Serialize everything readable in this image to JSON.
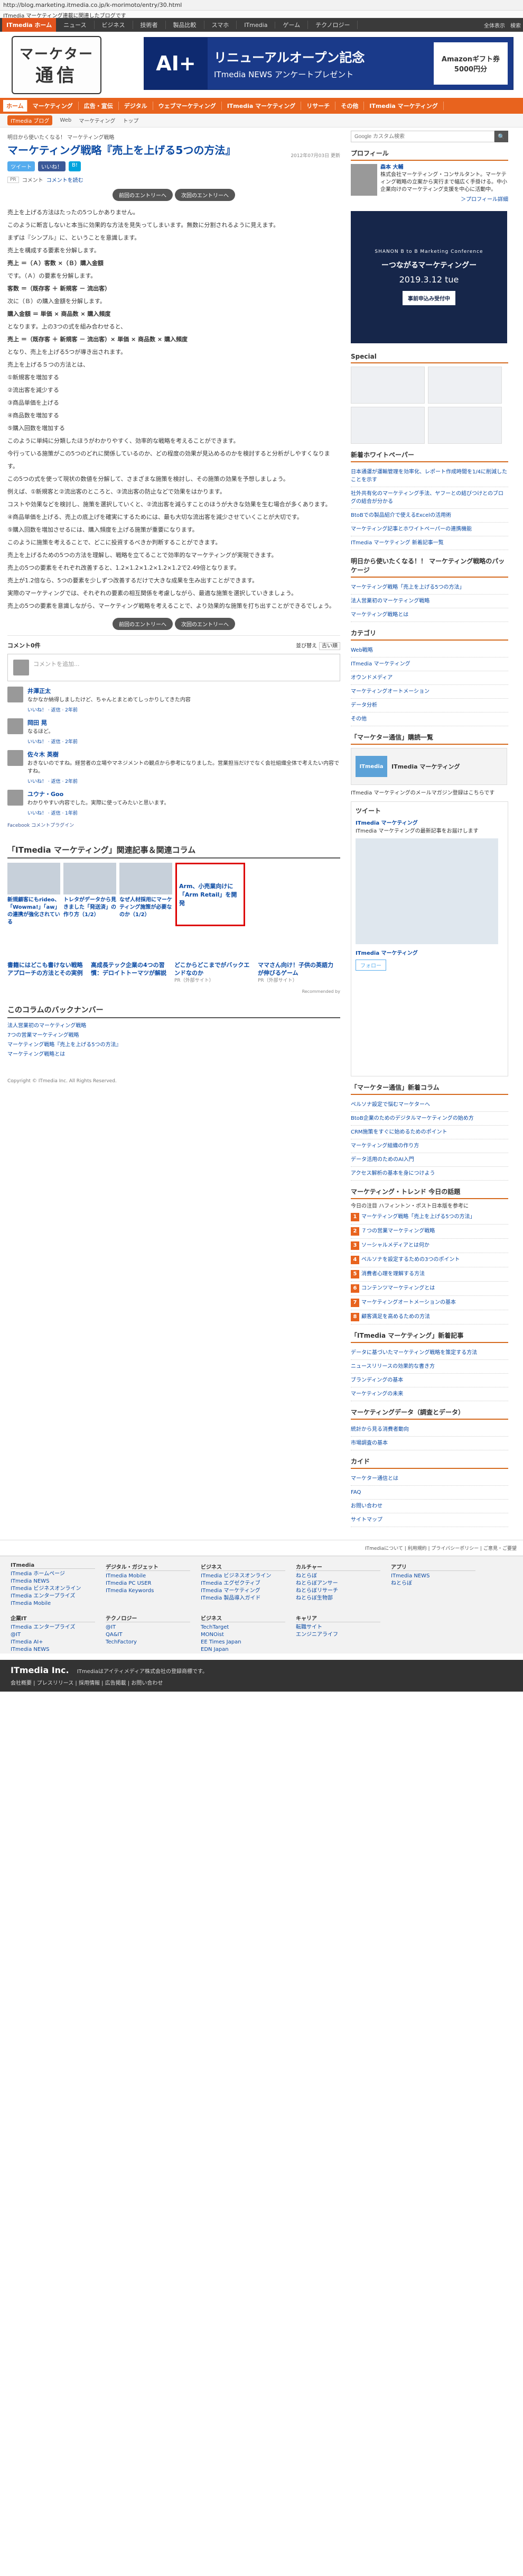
{
  "url": "http://blog.marketing.itmedia.co.jp/k-morimoto/entry/30.html",
  "infobar": "ITmedia マーケティング連載に関連したブログです",
  "topnav": {
    "home": "ITmedia ホーム",
    "items": [
      "ニュース",
      "ビジネス",
      "技術者",
      "製品比較",
      "スマホ",
      "ITmedia",
      "ゲーム",
      "テクノロジー"
    ],
    "right": [
      "全体表示",
      "検索"
    ]
  },
  "logo": {
    "line1": "マーケター",
    "line2": "通信"
  },
  "banner": {
    "left": "AI+",
    "title": "リニューアルオープン記念",
    "sub": "ITmedia NEWS アンケートプレゼント",
    "right": "Amazonギフト券 5000円分"
  },
  "catnav": [
    "ホーム",
    "マーケティング",
    "広告・宣伝",
    "デジタル",
    "ウェブマーケティング",
    "ITmedia マーケティング",
    "リサーチ",
    "その他",
    "ITmedia マーケティング"
  ],
  "crumb": {
    "s": "ITmedia ブログ",
    "items": [
      "Web",
      "マーケティング",
      "トップ"
    ]
  },
  "article": {
    "kicker": "明日から使いたくなる！ マーケティング戦略",
    "title": "マーケティング戦略『売上を上げる5つの方法』",
    "date": "2012年07月03日 更新",
    "social": [
      "ツイート",
      "いいね！",
      "B!"
    ],
    "meta": [
      "コメント",
      "コメントを読む"
    ],
    "tag": "PR",
    "nav_prev": "前回のエントリーへ",
    "nav_next": "次回のエントリーへ",
    "paragraphs": [
      "売上を上げる方法はたったの5つしかありません。",
      "このように断言しないと本当に効果的な方法を見失ってしまいます。無数に分割されるように見えます。",
      "まずは『シンプル』に、ということを意識します。",
      "売上を構成する要素を分解します。",
      "売上 ＝（Ａ）客数 ×（Ｂ）購入金額",
      "です。（Ａ）の要素を分解します。",
      "客数 ＝（既存客 ＋ 新規客 － 流出客）",
      "次に（Ｂ）の購入金額を分解します。",
      "購入金額 ＝ 単価 × 商品数 × 購入頻度",
      "となります。上の3つの式を組み合わせると、",
      "売上 ＝（既存客 ＋ 新規客 － 流出客）× 単価 × 商品数 × 購入頻度",
      "となり、売上を上げる5つが導き出されます。",
      "売上を上げる５つの方法とは、",
      "①新規客を増加する",
      "②流出客を減少する",
      "③商品単価を上げる",
      "④商品数を増加する",
      "⑤購入回数を増加する",
      "このように単純に分類したほうがわかりやすく、効率的な戦略を考えることができます。",
      "今行っている施策がこの5つのどれに関係しているのか、どの程度の効果が見込めるのかを検討すると分析がしやすくなります。",
      "この5つの式を使って現状の数値を分解して、さまざまな施策を検討し、その施策の効果を予想しましょう。",
      "例えば、①新規客と②流出客のところと、③流出客の防止などで効果をはかります。",
      "コストや効果などを検討し、施策を選択していくと、②流出客を減らすことのほうが大きな効果を生む場合が多くあります。",
      "④商品単価を上げる、売上の底上げを確実にするためには、最も大切な流出客を減少させていくことが大切です。",
      "⑤購入回数を増加させるには、購入頻度を上げる施策が重要になります。",
      "このように施策を考えることで、どこに投資するべきか判断することができます。",
      "売上を上げるための5つの方法を理解し、戦略を立てることで効率的なマーケティングが実現できます。",
      "売上の5つの要素をそれぞれ改善すると、1.2×1.2×1.2×1.2×1.2で2.49倍となります。",
      "売上が1.2倍なら、5つの要素を少しずつ改善するだけで大きな成果を生み出すことができます。",
      "実際のマーケティングでは、それぞれの要素の相互関係を考慮しながら、最適な施策を選択していきましょう。",
      "売上の5つの要素を意識しながら、マーケティング戦略を考えることで、より効果的な施策を打ち出すことができるでしょう。"
    ],
    "bold_idx": [
      4,
      6,
      8,
      10
    ]
  },
  "comments": {
    "title": "コメント0件",
    "sort": "並び替え",
    "new": "古い順",
    "placeholder": "コメントを追加...",
    "items": [
      {
        "name": "井澤正太",
        "text": "なかなか納得しましたけど、ちゃんとまとめてしっかりしてきた内容",
        "meta": "いいね！ · 返信 · 2年前"
      },
      {
        "name": "岡田 晃",
        "text": "なるほど。",
        "meta": "いいね！ · 返信 · 2年前"
      },
      {
        "name": "佐々木 英樹",
        "text": "おきないのですね。経営者の立場やマネジメントの観点から参考になりました。営業担当だけでなく会社組織全体で考えたい内容ですね。",
        "meta": "いいね！ · 返信 · 2年前"
      },
      {
        "name": "ユウナ・Goo",
        "text": "わかりやすい内容でした。実際に使ってみたいと思います。",
        "meta": "いいね！ · 返信 · 1年前"
      }
    ],
    "plugin": "Facebook コメントプラグイン"
  },
  "related": {
    "title": "「ITmedia マーケティング」関連記事＆関連コラム",
    "items": [
      "新規顧客にもrideo、「Wowma!」「aw」の連携が強化されている",
      "トレタがデータから見きました「発送済」の作り方（1/2）",
      "なぜ人材採用にマーケティング施策が必要なのか（1/2）",
      "Arm、小売業向けに「Arm Retail」を開発"
    ]
  },
  "recs": [
    {
      "t": "",
      "s": ""
    },
    {
      "t": "書籍にはどこも書けない戦略アプローチの方法とその実例",
      "s": ""
    },
    {
      "t": "高成長テック企業の4つの習慣：デロイトトーマツが解説",
      "s": ""
    },
    {
      "t": "どこからどこまでがバックエンドなのか",
      "s": "PR（外部サイト）"
    },
    {
      "t": "ママさん向け！子供の英語力が伸びるゲーム",
      "s": "PR（外部サイト）"
    }
  ],
  "rec_footer": "Recommended by",
  "backnumber": {
    "title": "このコラムのバックナンバー",
    "items": [
      "法人営業初のマーケティング戦略",
      "7つの営業マーケティング戦略",
      "マーケティング戦略『売上を上げる5つの方法』",
      "マーケティング戦略とは"
    ]
  },
  "copyright": "Copyright © ITmedia Inc. All Rights Reserved.",
  "sidebar": {
    "search_placeholder": "Google カスタム検索",
    "profile_title": "プロフィール",
    "profile_name": "森本 大輔",
    "profile_text": "株式会社マーケティング・コンサルタント。マーケティング戦略の立案から実行まで幅広く手掛ける。中小企業向けのマーケティング支援を中心に活動中。",
    "profile_link": "＞プロフィール詳細",
    "ad": {
      "a": "SHANON B to B Marketing Conference",
      "b": "ーつながるマーケティングー",
      "c": "2019.3.12 tue",
      "d": "事前申込み受付中"
    },
    "special_title": "Special",
    "newarrivals_title": "新着ホワイトペーパー",
    "newarrivals": [
      "日本通運が運輸管理を効率化、レポート作成時間を1/4に削減したことを示す",
      "社外共有化のマーケティング手法、ヤフーとの結びつけとのブログの結合が分かる",
      "BtoBでの製品紹介で使えるExcelの活用術",
      "マーケティング記事とホワイトペーパーの連携機能",
      "ITmedia マーケティング 新着記事一覧"
    ],
    "mm": {
      "title": "ITmedia マーケティング",
      "logo": "ITmedia"
    },
    "mm2": "ITmedia マーケティングのメールマガジン登録はこちらです",
    "toptitle": "明日から使いたくなる！！ マーケティング戦略のパッケージ",
    "topitems": [
      "マーケティング戦略「売上を上げる5つの方法」",
      "法人営業初のマーケティング戦略",
      "マーケティング戦略とは"
    ],
    "cat_title": "カテゴリ",
    "cats": [
      "Web戦略",
      "ITmedia マーケティング",
      "オウンドメディア",
      "マーケティングオートメーション",
      "データ分析",
      "その他"
    ],
    "column_title": "「マーケター通信」購読一覧",
    "twitter_title": "ITmedia マーケティング",
    "tweet_title": "ツイート",
    "tweet_text": "ITmedia マーケティングの最新記事をお届けします",
    "follow": "フォロー",
    "nt_title": "「マーケター通信」新着コラム",
    "nt_items": [
      "ペルソナ設定で悩むマーケターへ",
      "BtoB企業のためのデジタルマーケティングの始め方",
      "CRM施策をすぐに始めるためのポイント",
      "マーケティング組織の作り方",
      "データ活用のためのAI入門",
      "アクセス解析の基本を身につけよう"
    ],
    "rk_title": "マーケティング・トレンド 今日の話題",
    "rk_sub": "今日の注目 ハフィントン・ポスト日本版を参考に",
    "rk_items": [
      "マーケティング戦略「売上を上げる5つの方法」",
      "７つの営業マーケティング戦略",
      "ソーシャルメディアとは何か",
      "ペルソナを設定するための3つのポイント",
      "消費者心理を理解する方法",
      "コンテンツマーケティングとは",
      "マーケティングオートメーションの基本",
      "顧客満足を高めるための方法"
    ],
    "mkt_title": "「ITmedia マーケティング」新着記事",
    "mkt_items": [
      "データに基づいたマーケティング戦略を策定する方法",
      "ニュースリリースの効果的な書き方",
      "ブランディングの基本",
      "マーケティングの未来"
    ],
    "cat2_title": "マーケティングデータ（調査とデータ）",
    "cat2_items": [
      "統計から見る消費者動向",
      "市場調査の基本"
    ],
    "kaido_title": "カイド",
    "kaido_items": [
      "マーケター通信とは",
      "FAQ",
      "お問い合わせ",
      "サイトマップ"
    ]
  },
  "footlinks": "ITmediaについて | 利用規約 | プライバシーポリシー | ご意見・ご要望",
  "footer": {
    "cols": [
      {
        "h": "ITmedia",
        "items": [
          "ITmedia ホームページ",
          "ITmedia NEWS",
          "ITmedia ビジネスオンライン",
          "ITmedia エンタープライズ",
          "ITmedia Mobile"
        ]
      },
      {
        "h": "デジタル・ガジェット",
        "items": [
          "ITmedia Mobile",
          "ITmedia PC USER",
          "ITmedia Keywords"
        ]
      },
      {
        "h": "ビジネス",
        "items": [
          "ITmedia ビジネスオンライン",
          "ITmedia エグゼクティブ",
          "ITmedia マーケティング",
          "ITmedia 製品導入ガイド"
        ]
      },
      {
        "h": "カルチャー",
        "items": [
          "ねとらぼ",
          "ねとらぼアンサー",
          "ねとらぼリサーチ",
          "ねとらぼ生物部"
        ]
      },
      {
        "h": "アプリ",
        "items": [
          "ITmedia NEWS",
          "ねとらぼ"
        ]
      }
    ],
    "cols2": [
      {
        "h": "企業IT",
        "items": [
          "ITmedia エンタープライズ",
          "@IT",
          "ITmedia AI+",
          "ITmedia NEWS"
        ]
      },
      {
        "h": "テクノロジー",
        "items": [
          "@IT",
          "QA&IT",
          "TechFactory"
        ]
      },
      {
        "h": "ビジネス",
        "items": [
          "TechTarget",
          "MONOist",
          "EE Times Japan",
          "EDN Japan"
        ]
      },
      {
        "h": "キャリア",
        "items": [
          "転職サイト",
          "エンジニアライフ"
        ]
      }
    ]
  },
  "copyright_bar": {
    "logo": "ITmedia Inc.",
    "text": "ITmediaはアイティメディア株式会社の登録商標です。",
    "links": "会社概要 | プレスリリース | 採用情報 | 広告掲載 | お問い合わせ"
  }
}
